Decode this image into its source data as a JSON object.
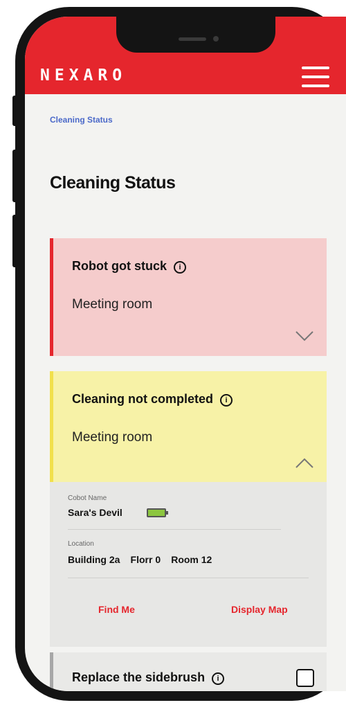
{
  "app": {
    "logo": "NEXARO",
    "menu_icon": "hamburger-menu-icon",
    "accent_color": "#e5262d"
  },
  "breadcrumb": "Cleaning Status",
  "page_title": "Cleaning Status",
  "alerts": [
    {
      "title": "Robot got stuck",
      "location": "Meeting room",
      "status_color": "#e5262d",
      "background": "#f5cccc",
      "expanded": false
    },
    {
      "title": "Cleaning not completed",
      "location": "Meeting room",
      "status_color": "#f1e04c",
      "background": "#f7f2a7",
      "expanded": true,
      "details": {
        "cobot_name_label": "Cobot Name",
        "cobot_name": "Sara's Devil",
        "battery_icon": "battery-icon",
        "location_label": "Location",
        "building": "Building 2a",
        "floor": "Florr 0",
        "room": "Room 12",
        "find_me": "Find Me",
        "display_map": "Display Map"
      }
    },
    {
      "title": "Replace the sidebrush",
      "status_color": "#a7a7a7",
      "background": "#e9e9e7",
      "checked": false
    }
  ]
}
